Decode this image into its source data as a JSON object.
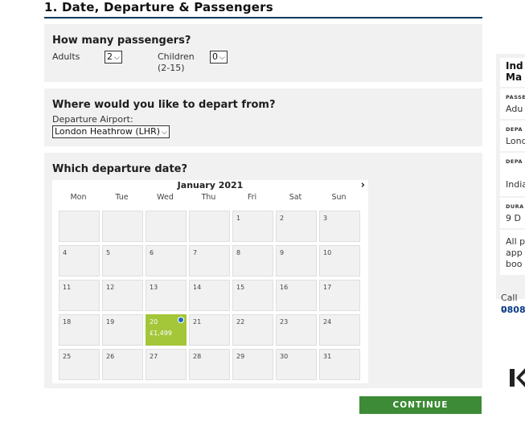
{
  "section": {
    "title": "1. Date, Departure & Passengers"
  },
  "passengers": {
    "heading": "How many passengers?",
    "adults_label": "Adults",
    "adults_value": "2",
    "children_label": "Children",
    "children_age": "(2-15)",
    "children_value": "0"
  },
  "departure": {
    "heading": "Where would you like to depart from?",
    "airport_label": "Departure Airport:",
    "airport_value": "London Heathrow (LHR)"
  },
  "date": {
    "heading": "Which departure date?",
    "month": "January 2021",
    "next_icon": "chevron-right-icon",
    "weekdays": [
      "Mon",
      "Tue",
      "Wed",
      "Thu",
      "Fri",
      "Sat",
      "Sun"
    ],
    "leading_blanks": 4,
    "days": [
      "1",
      "2",
      "3",
      "4",
      "5",
      "6",
      "7",
      "8",
      "9",
      "10",
      "11",
      "12",
      "13",
      "14",
      "15",
      "16",
      "17",
      "18",
      "19",
      "20",
      "21",
      "22",
      "23",
      "24",
      "25",
      "26",
      "27",
      "28",
      "29",
      "30",
      "31"
    ],
    "selected_day": "20",
    "selected_price": "£1,499",
    "selected_color": "#a4c639"
  },
  "continue_label": "CONTINUE",
  "continue_color": "#3d8b37",
  "summary": {
    "title_line1": "Ind",
    "title_line2": "Ma",
    "passengers_cap": "PASSE",
    "passengers_val": "Adu",
    "departure_cap": "DEPA",
    "departure_val": "Lond",
    "date_cap": "DEPA",
    "date_val": "India",
    "duration_cap": "DURA",
    "duration_val": "9 D",
    "note_line1": "All p",
    "note_line2": "app",
    "note_line3": "boo",
    "call_text": "Call u",
    "call_number": "0808"
  }
}
